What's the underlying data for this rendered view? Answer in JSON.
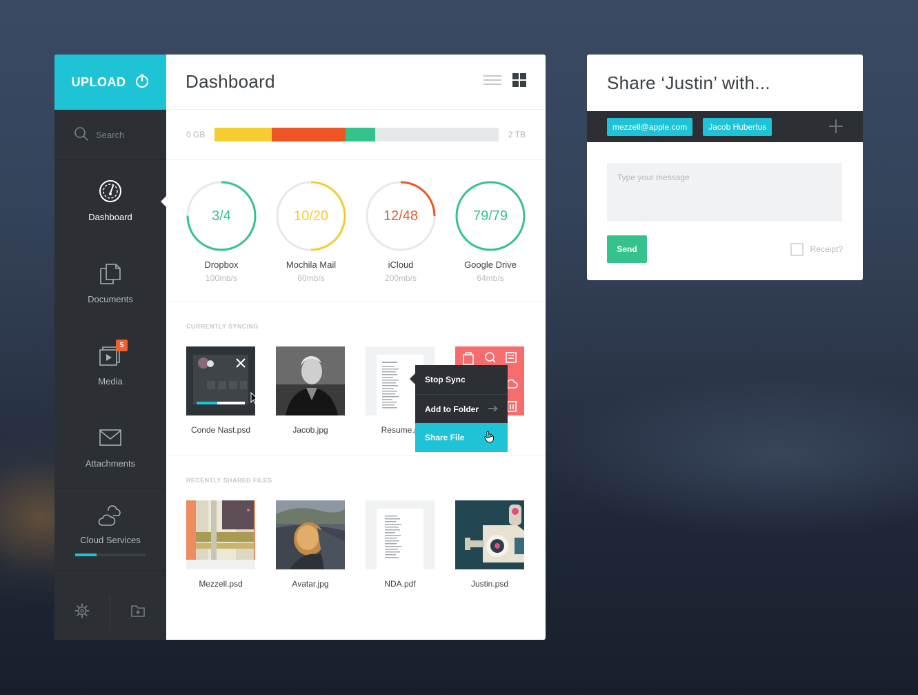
{
  "sidebar": {
    "upload_label": "UPLOAD",
    "search_placeholder": "Search",
    "items": [
      {
        "label": "Dashboard",
        "icon": "gauge-icon"
      },
      {
        "label": "Documents",
        "icon": "documents-icon"
      },
      {
        "label": "Media",
        "icon": "media-icon",
        "badge": "5"
      },
      {
        "label": "Attachments",
        "icon": "envelope-icon"
      },
      {
        "label": "Cloud Services",
        "icon": "cloud-icon",
        "progress": 0.3
      }
    ],
    "footer": {
      "settings_icon": "gear-icon",
      "new_folder_icon": "folder-plus-icon"
    }
  },
  "dashboard": {
    "title": "Dashboard",
    "view_icons": [
      "list-view-icon",
      "grid-view-icon"
    ],
    "storage": {
      "min_label": "0 GB",
      "max_label": "2 TB",
      "segments": [
        {
          "fraction": 0.2,
          "color": "#f6cd30"
        },
        {
          "fraction": 0.26,
          "color": "#ee5522"
        },
        {
          "fraction": 0.105,
          "color": "#35c38c"
        }
      ]
    },
    "services": [
      {
        "name": "Dropbox",
        "value": "3/4",
        "speed": "100mb/s",
        "color": "#35c38c",
        "fraction": 0.75
      },
      {
        "name": "Mochila Mail",
        "value": "10/20",
        "speed": "60mb/s",
        "color": "#f6cd30",
        "fraction": 0.5
      },
      {
        "name": "iCloud",
        "value": "12/48",
        "speed": "200mb/s",
        "color": "#ee5522",
        "fraction": 0.25
      },
      {
        "name": "Google Drive",
        "value": "79/79",
        "speed": "64mb/s",
        "color": "#35c38c",
        "fraction": 1.0
      }
    ],
    "currently_syncing": {
      "title": "CURRENTLY SYNCING",
      "files": [
        {
          "name": "Conde Nast.psd"
        },
        {
          "name": "Jacob.jpg"
        },
        {
          "name": "Resume.p"
        },
        {
          "name": ""
        }
      ]
    },
    "context_menu": {
      "items": [
        "Stop Sync",
        "Add to Folder",
        "Share File"
      ]
    },
    "recently_shared": {
      "title": "RECENTLY SHARED FILES",
      "files": [
        {
          "name": "Mezzell.psd"
        },
        {
          "name": "Avatar.jpg"
        },
        {
          "name": "NDA.pdf"
        },
        {
          "name": "Justin.psd"
        }
      ]
    }
  },
  "share": {
    "title": "Share ‘Justin’ with...",
    "recipients": [
      "mezzell@apple.com",
      "Jacob Hubertus"
    ],
    "message_placeholder": "Type your message",
    "send_label": "Send",
    "receipt_label": "Receipt?"
  }
}
